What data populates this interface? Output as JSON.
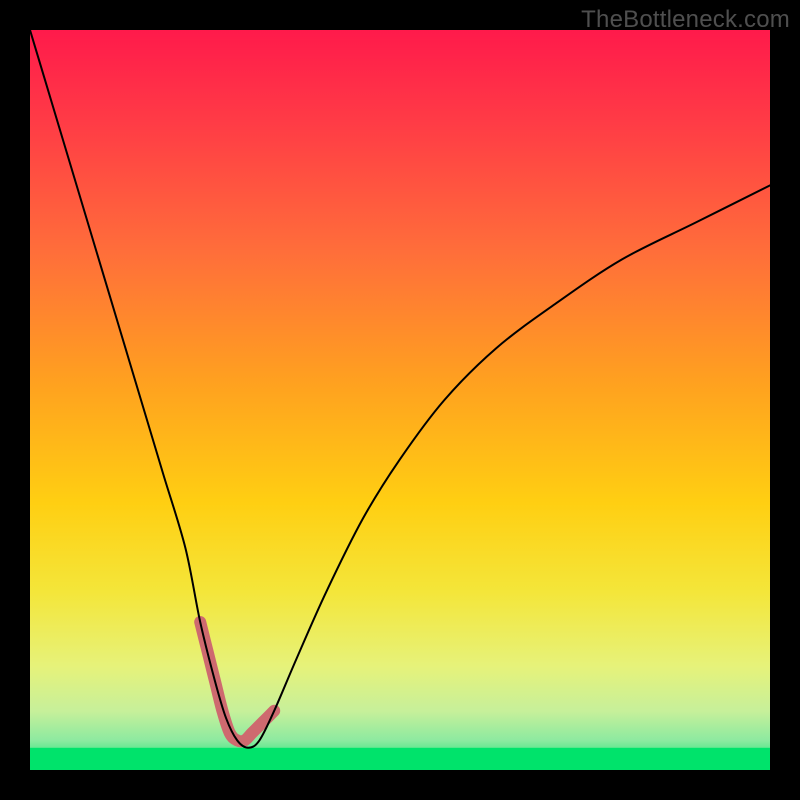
{
  "watermark": {
    "text": "TheBottleneck.com"
  },
  "chart_data": {
    "type": "line",
    "title": "",
    "xlabel": "",
    "ylabel": "",
    "xlim": [
      0,
      100
    ],
    "ylim": [
      0,
      100
    ],
    "grid": false,
    "legend": null,
    "background_gradient": {
      "top_color": "#ff1a4b",
      "mid_color": "#ffd400",
      "bottom_color": "#00e36b",
      "mid_stop": 0.74
    },
    "green_band": {
      "y0": 0,
      "y1": 3,
      "color": "#00e36b"
    },
    "series": [
      {
        "name": "bottleneck-curve",
        "color": "#000000",
        "stroke_width": 2,
        "x": [
          0,
          3,
          6,
          9,
          12,
          15,
          18,
          21,
          23,
          25,
          26.5,
          28,
          29.5,
          31,
          33,
          36,
          40,
          45,
          50,
          56,
          63,
          71,
          80,
          90,
          100
        ],
        "values": [
          100,
          90,
          80,
          70,
          60,
          50,
          40,
          30,
          20,
          12,
          7,
          4,
          3,
          4,
          8,
          15,
          24,
          34,
          42,
          50,
          57,
          63,
          69,
          74,
          79
        ]
      },
      {
        "name": "highlight-valley",
        "color": "#ce6a6f",
        "stroke_width": 12,
        "x": [
          23,
          24,
          25,
          26,
          27,
          28,
          29,
          30,
          31,
          32,
          33
        ],
        "values": [
          20,
          16,
          12,
          8,
          5,
          4,
          4,
          5,
          6,
          7,
          8
        ]
      }
    ]
  }
}
